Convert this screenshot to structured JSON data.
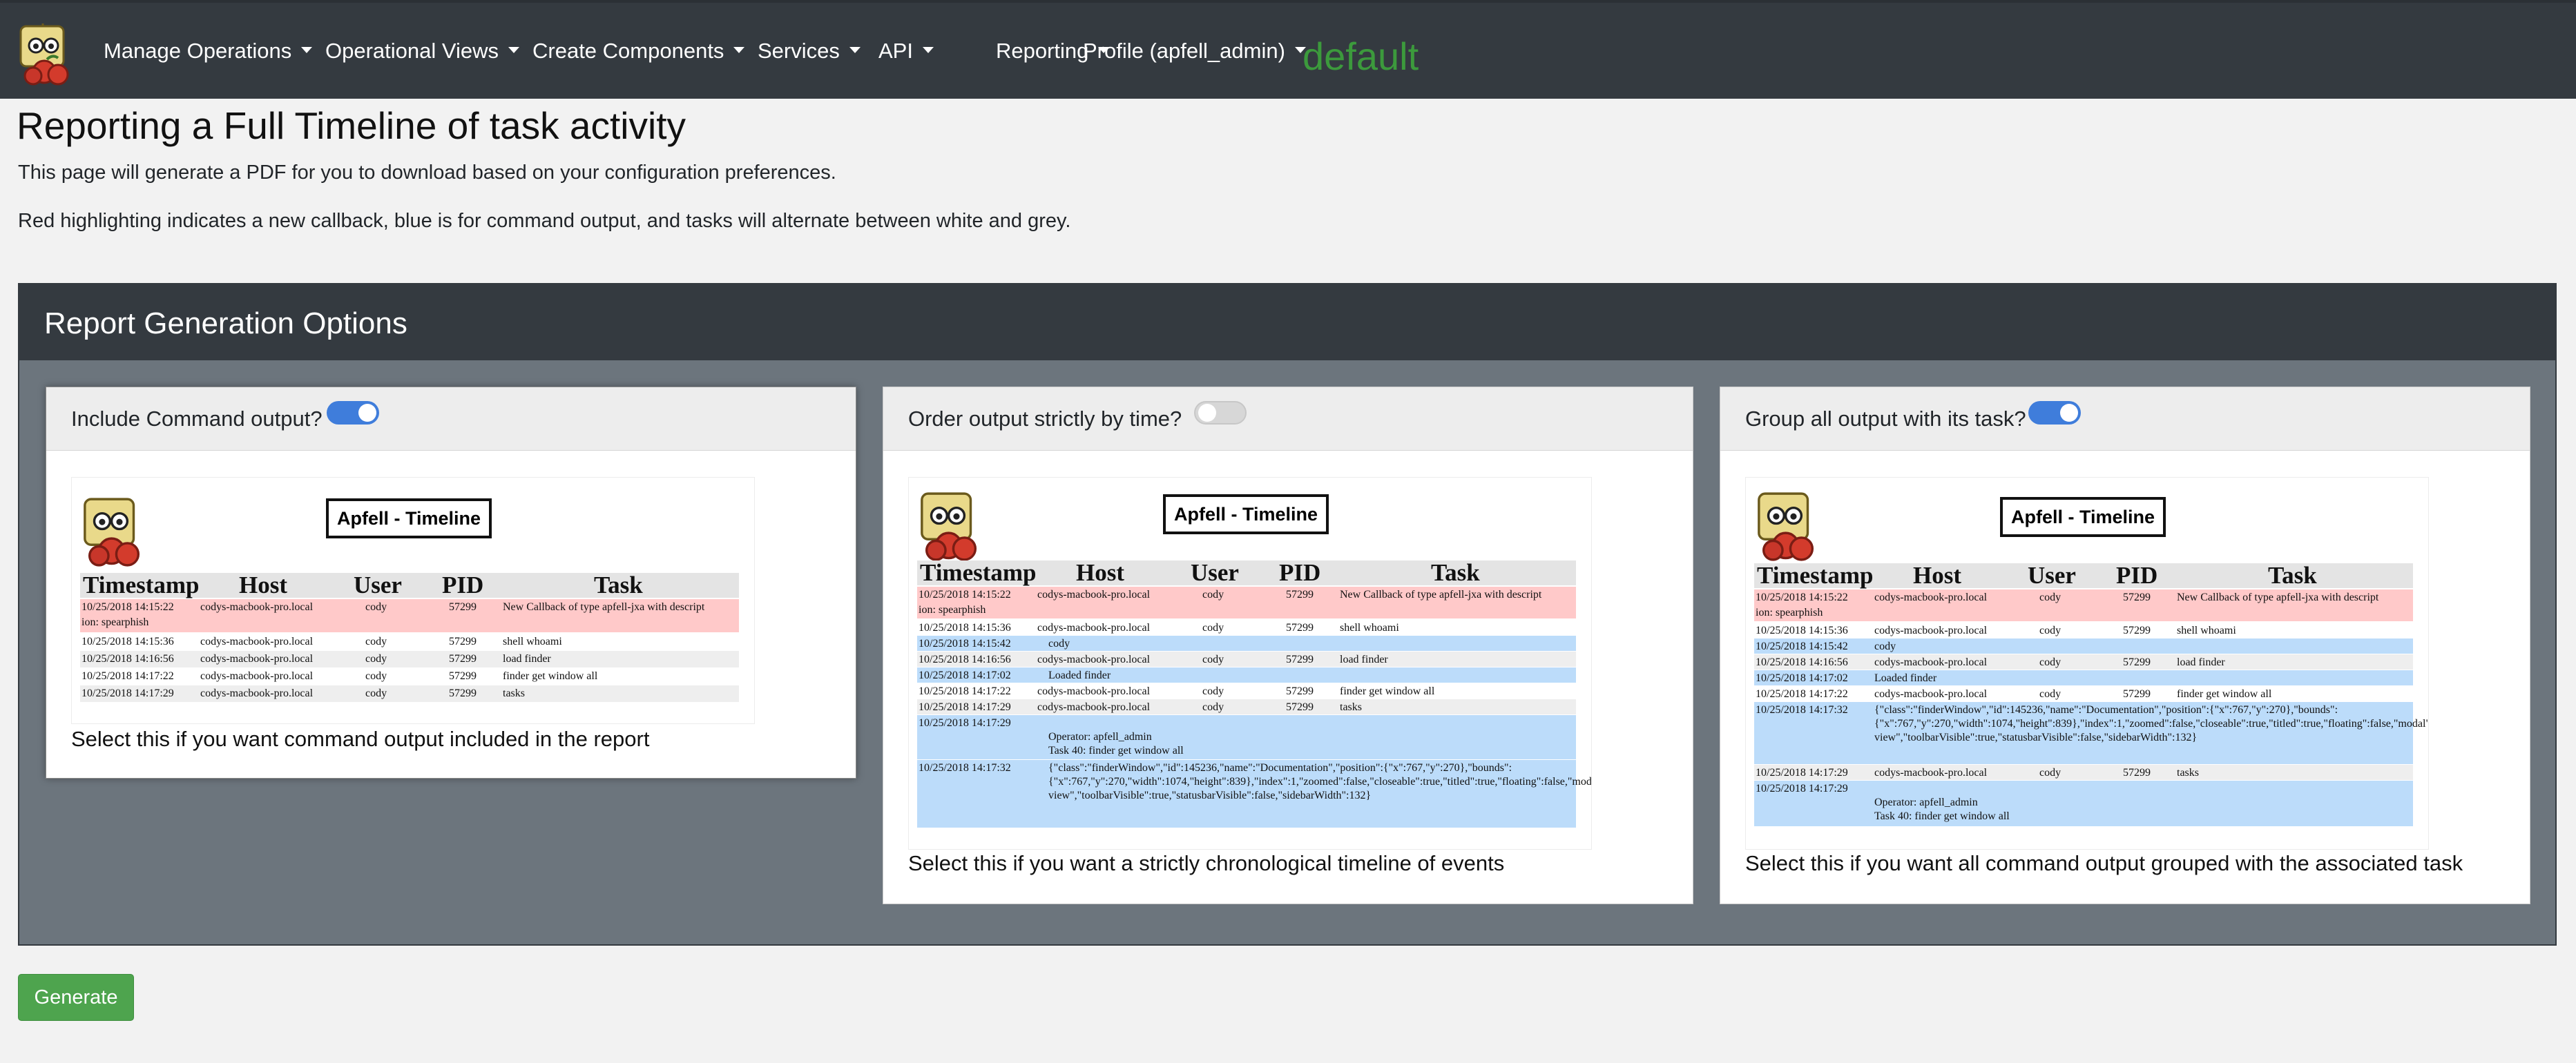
{
  "nav": {
    "items": [
      {
        "label": "Manage Operations"
      },
      {
        "label": "Operational Views"
      },
      {
        "label": "Create Components"
      },
      {
        "label": "Services"
      },
      {
        "label": "API"
      },
      {
        "label": "Reporting"
      },
      {
        "label": "Profile (apfell_admin)"
      }
    ],
    "operation": "default"
  },
  "page": {
    "title": "Reporting a Full Timeline of task activity",
    "description1": "This page will generate a PDF for you to download based on your configuration preferences.",
    "description2": "Red highlighting indicates a new callback, blue is for command output, and tasks will alternate between white and grey."
  },
  "options": {
    "title": "Report Generation Options",
    "cards": [
      {
        "label": "Include Command output?",
        "enabled": true,
        "caption": "Select this if you want command output included in the report"
      },
      {
        "label": "Order output strictly by time?",
        "enabled": false,
        "caption": "Select this if you want a strictly chronological timeline of events"
      },
      {
        "label": "Group all output with its task?",
        "enabled": true,
        "caption": "Select this if you want all command output grouped with the associated task"
      }
    ]
  },
  "preview": {
    "title": "Apfell - Timeline",
    "headers": [
      "Timestamp",
      "Host",
      "User",
      "PID",
      "Task"
    ],
    "rows": {
      "r1": {
        "time": "10/25/2018 14:15:22",
        "host": "codys-macbook-pro.local",
        "user": "cody",
        "pid": "57299",
        "task": "New Callback of type apfell-jxa with descript",
        "cont": "ion: spearphish"
      },
      "r2": {
        "time": "10/25/2018 14:15:36",
        "host": "codys-macbook-pro.local",
        "user": "cody",
        "pid": "57299",
        "task": "shell whoami"
      },
      "r3": {
        "time": "10/25/2018 14:16:56",
        "host": "codys-macbook-pro.local",
        "user": "cody",
        "pid": "57299",
        "task": "load finder"
      },
      "r4": {
        "time": "10/25/2018 14:17:22",
        "host": "codys-macbook-pro.local",
        "user": "cody",
        "pid": "57299",
        "task": "finder get window all"
      },
      "r5": {
        "time": "10/25/2018 14:17:29",
        "host": "codys-macbook-pro.local",
        "user": "cody",
        "pid": "57299",
        "task": "tasks"
      },
      "o1": {
        "time": "10/25/2018 14:15:42",
        "text": "cody"
      },
      "o2": {
        "time": "10/25/2018 14:17:02",
        "text": "Loaded finder"
      },
      "o3": {
        "time": "10/25/2018 14:17:29",
        "operator": "Operator: apfell_admin",
        "task": "Task 40: finder get window all"
      },
      "o4": {
        "time": "10/25/2018 14:17:32",
        "text": "{\"class\":\"finderWindow\",\"id\":145236,\"name\":\"Documentation\",\"position\":{\"x\":767,\"y\":270},\"bounds\":{\"x\":767,\"y\":270,\"width\":1074,\"height\":839},\"index\":1,\"zoomed\":false,\"closeable\":true,\"titled\":true,\"floating\":false,\"modal\":false,\"resizable\":true,\"zoomable\":true,\"visible\":false,\"collapsed\":true,\"currentView\":\"icon view\",\"toolbarVisible\":true,\"statusbarVisible\":false,\"sidebarWidth\":132}"
      }
    }
  },
  "generate_label": "Generate"
}
